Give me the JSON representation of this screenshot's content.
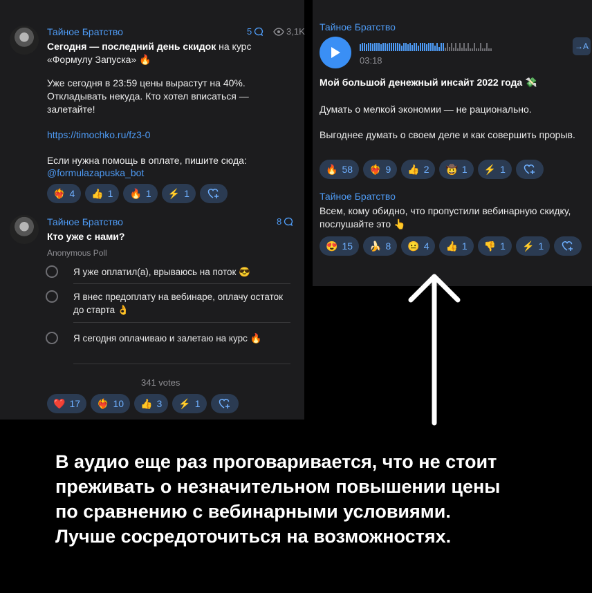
{
  "left_post1": {
    "author": "Тайное Братство",
    "comments": "5",
    "views": "3,1K",
    "title_bold": "Сегодня — последний день скидок",
    "title_rest": " на курс «Формулу Запуска» 🔥",
    "para1": "Уже сегодня в 23:59 цены вырастут на 40%. Откладывать некуда. Кто хотел вписаться — залетайте!",
    "link": "https://timochko.ru/fz3-0",
    "para2": "Если нужна помощь в оплате, пишите сюда:",
    "bot": "@formulazapuska_bot",
    "reactions": [
      {
        "emoji": "❤️‍🔥",
        "count": "4"
      },
      {
        "emoji": "👍",
        "count": "1"
      },
      {
        "emoji": "🔥",
        "count": "1"
      },
      {
        "emoji": "⚡",
        "count": "1"
      }
    ]
  },
  "left_post2": {
    "author": "Тайное Братство",
    "comments": "8",
    "question": "Кто уже с нами?",
    "poll_type": "Anonymous Poll",
    "options": [
      "Я уже оплатил(а), врываюсь на поток 😎",
      "Я внес предоплату на вебинаре, оплачу остаток до старта 👌",
      "Я сегодня оплачиваю и залетаю на курс 🔥"
    ],
    "votes": "341 votes",
    "reactions": [
      {
        "emoji": "❤️",
        "count": "17"
      },
      {
        "emoji": "❤️‍🔥",
        "count": "10"
      },
      {
        "emoji": "👍",
        "count": "3"
      },
      {
        "emoji": "⚡",
        "count": "1"
      }
    ]
  },
  "right_post1": {
    "author": "Тайное Братство",
    "duration": "03:18",
    "forward_label": "→A",
    "title": "Мой большой денежный инсайт 2022 года 💸",
    "para1": "Думать о мелкой экономии — не рационально.",
    "para2": "Выгоднее думать о своем деле и как совершить прорыв.",
    "reactions": [
      {
        "emoji": "🔥",
        "count": "58"
      },
      {
        "emoji": "❤️‍🔥",
        "count": "9"
      },
      {
        "emoji": "👍",
        "count": "2"
      },
      {
        "emoji": "🤠",
        "count": "1"
      },
      {
        "emoji": "⚡",
        "count": "1"
      }
    ]
  },
  "right_post2": {
    "author": "Тайное Братство",
    "text": "Всем, кому обидно, что пропустили вебинарную скидку, послушайте это 👆",
    "reactions": [
      {
        "emoji": "😍",
        "count": "15"
      },
      {
        "emoji": "🍌",
        "count": "8"
      },
      {
        "emoji": "😐",
        "count": "4"
      },
      {
        "emoji": "👍",
        "count": "1"
      },
      {
        "emoji": "👎",
        "count": "1"
      },
      {
        "emoji": "⚡",
        "count": "1"
      }
    ]
  },
  "caption": [
    "В аудио еще раз проговаривается, что не стоит",
    "преживать о незначительном повышении цены",
    "по сравнению с вебинарными условиями.",
    "Лучше сосредоточиться на возможностях."
  ],
  "colors": {
    "accent": "#4e9bf5",
    "panel": "#1c1c1e",
    "chip": "#2b3b52",
    "background": "#000000"
  }
}
